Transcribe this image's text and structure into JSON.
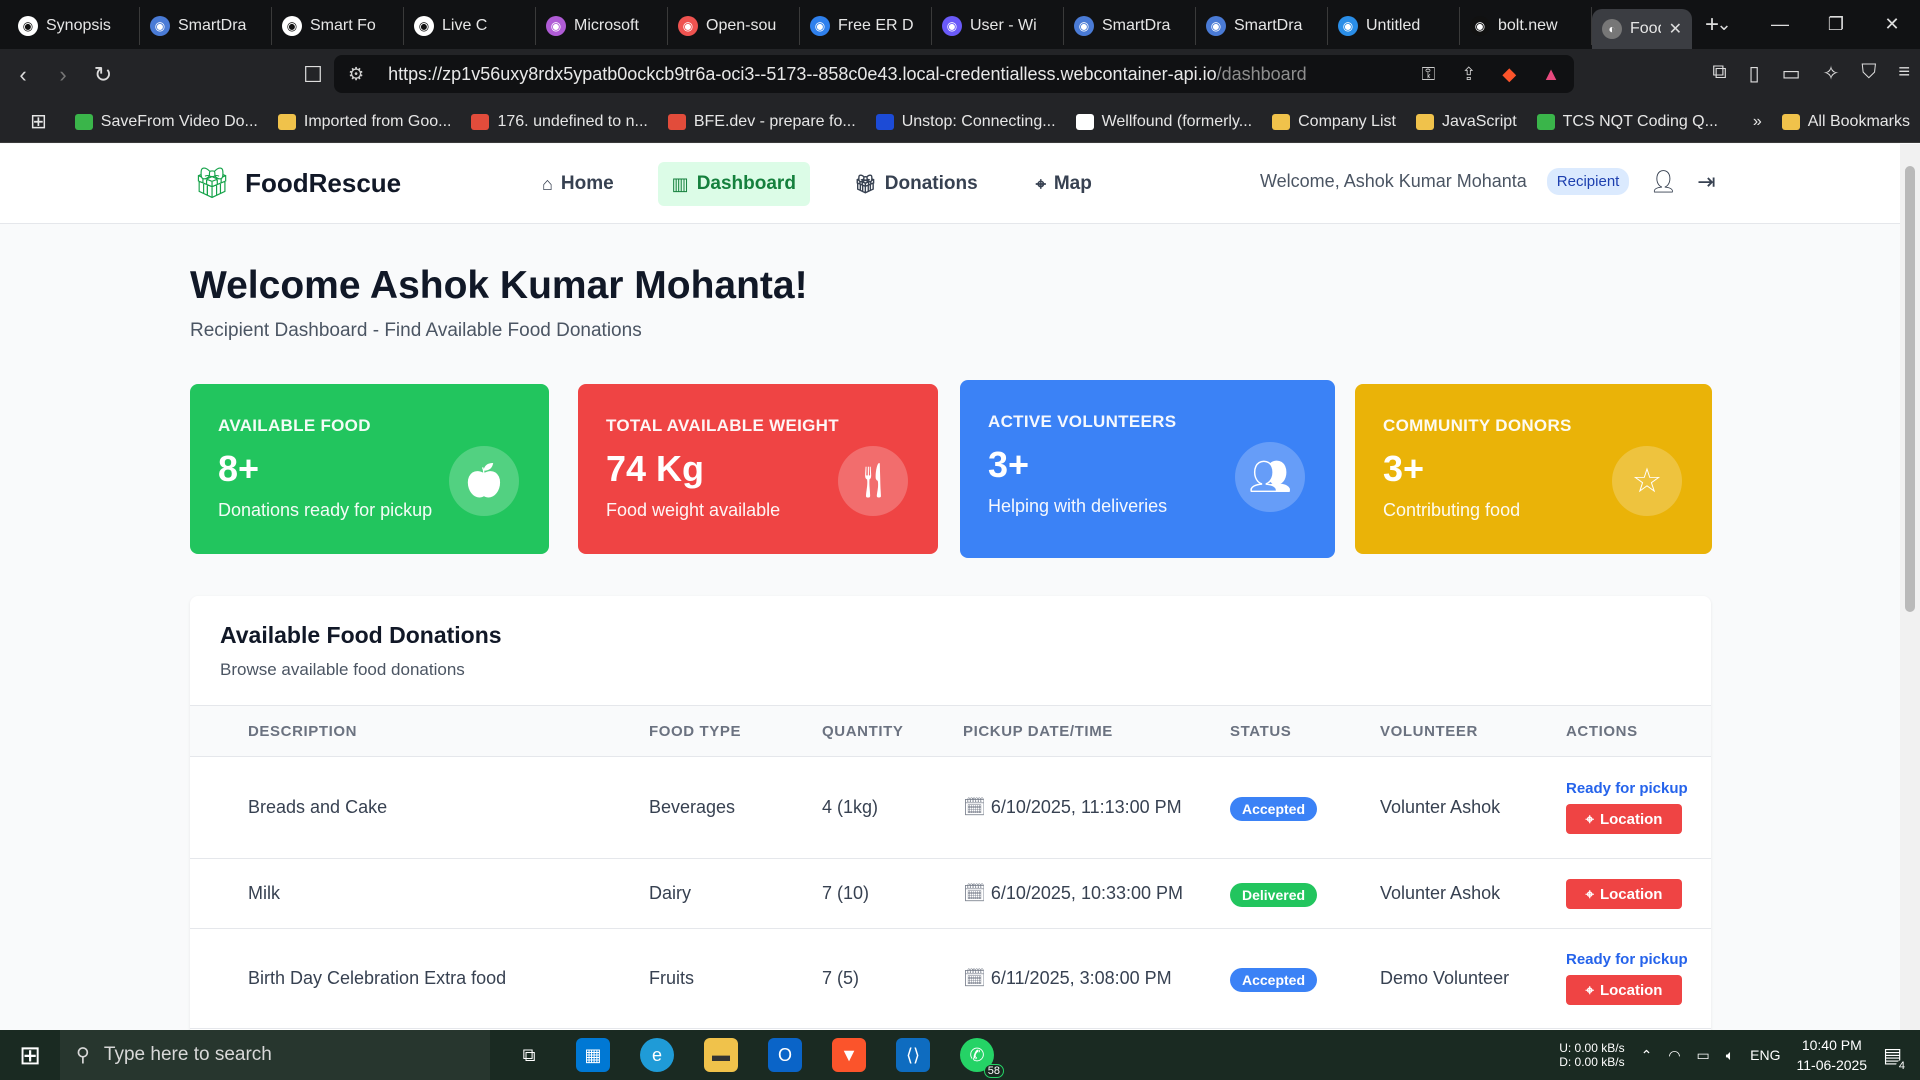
{
  "browser": {
    "tabs": [
      {
        "title": "Synopsis",
        "icon": "github-icon",
        "color": "#ffffff"
      },
      {
        "title": "SmartDra",
        "icon": "app-icon",
        "color": "#4a7bd6"
      },
      {
        "title": "Smart Fo",
        "icon": "openai-icon",
        "color": "#ffffff"
      },
      {
        "title": "Live C",
        "icon": "meet-icon",
        "color": "#ffffff"
      },
      {
        "title": "Microsoft",
        "icon": "copilot-icon",
        "color": "#b05cd6"
      },
      {
        "title": "Open-sou",
        "icon": "chrome-icon",
        "color": "#ef5350"
      },
      {
        "title": "Free ER D",
        "icon": "canva-icon",
        "color": "#2f80ed"
      },
      {
        "title": "User - Wi",
        "icon": "app-icon",
        "color": "#6a5af9"
      },
      {
        "title": "SmartDra",
        "icon": "app-icon",
        "color": "#4a7bd6"
      },
      {
        "title": "SmartDra",
        "icon": "app-icon",
        "color": "#4a7bd6"
      },
      {
        "title": "Untitled",
        "icon": "app-icon",
        "color": "#2a8ee8"
      },
      {
        "title": "bolt.new",
        "icon": "bolt-icon",
        "color": "#111111"
      }
    ],
    "active_tab": {
      "title": "Food"
    },
    "url_main": "https://zp1v56uxy8rdx5ypatb0ockcb9tr6a-oci3--5173--858c0e43.local-credentialless.webcontainer-api.io",
    "url_path": "/dashboard",
    "bookmarks": [
      {
        "label": "SaveFrom Video Do...",
        "color": "#3ab54a"
      },
      {
        "label": "Imported from Goo...",
        "color": "#f0c24b"
      },
      {
        "label": "176. undefined to n...",
        "color": "#e24c3b"
      },
      {
        "label": "BFE.dev - prepare fo...",
        "color": "#e24c3b"
      },
      {
        "label": "Unstop: Connecting...",
        "color": "#1c4bd6"
      },
      {
        "label": "Wellfound (formerly...",
        "color": "#ffffff"
      },
      {
        "label": "Company List",
        "color": "#f0c24b"
      },
      {
        "label": "JavaScript",
        "color": "#f0c24b"
      },
      {
        "label": "TCS NQT Coding Q...",
        "color": "#3ab54a"
      }
    ],
    "all_bookmarks": "All Bookmarks"
  },
  "app": {
    "brand": "FoodRescue",
    "nav": [
      {
        "label": "Home",
        "icon": "home-icon",
        "active": false
      },
      {
        "label": "Dashboard",
        "icon": "chart-icon",
        "active": true
      },
      {
        "label": "Donations",
        "icon": "gift-icon",
        "active": false
      },
      {
        "label": "Map",
        "icon": "map-pin-icon",
        "active": false
      }
    ],
    "welcome": "Welcome, Ashok Kumar Mohanta",
    "role": "Recipient"
  },
  "dashboard": {
    "title": "Welcome Ashok Kumar Mohanta!",
    "subtitle": "Recipient Dashboard - Find Available Food Donations",
    "stats": [
      {
        "label": "AVAILABLE FOOD",
        "value": "8+",
        "desc": "Donations ready for pickup",
        "icon": "apple-icon",
        "color": "#22c55e"
      },
      {
        "label": "TOTAL AVAILABLE WEIGHT",
        "value": "74 Kg",
        "desc": "Food weight available",
        "icon": "utensils-icon",
        "color": "#ef4444"
      },
      {
        "label": "ACTIVE VOLUNTEERS",
        "value": "3+",
        "desc": "Helping with deliveries",
        "icon": "users-icon",
        "color": "#3b82f6"
      },
      {
        "label": "COMMUNITY DONORS",
        "value": "3+",
        "desc": "Contributing food",
        "icon": "star-icon",
        "color": "#eab308"
      }
    ],
    "donations": {
      "title": "Available Food Donations",
      "subtitle": "Browse available food donations",
      "columns": [
        "DESCRIPTION",
        "FOOD TYPE",
        "QUANTITY",
        "PICKUP DATE/TIME",
        "STATUS",
        "VOLUNTEER",
        "ACTIONS"
      ],
      "rows": [
        {
          "description": "Breads and Cake",
          "food_type": "Beverages",
          "quantity": "4 (1kg)",
          "pickup": "6/10/2025, 11:13:00 PM",
          "status": "Accepted",
          "volunteer": "Volunter Ashok",
          "ready": "Ready for pickup",
          "action": "Location"
        },
        {
          "description": "Milk",
          "food_type": "Dairy",
          "quantity": "7 (10)",
          "pickup": "6/10/2025, 10:33:00 PM",
          "status": "Delivered",
          "volunteer": "Volunter Ashok",
          "ready": "",
          "action": "Location"
        },
        {
          "description": "Birth Day Celebration Extra food",
          "food_type": "Fruits",
          "quantity": "7 (5)",
          "pickup": "6/11/2025, 3:08:00 PM",
          "status": "Accepted",
          "volunteer": "Demo Volunteer",
          "ready": "Ready for pickup",
          "action": "Location"
        }
      ],
      "status_colors": {
        "Accepted": "#3b82f6",
        "Delivered": "#22c55e"
      }
    }
  },
  "taskbar": {
    "search_placeholder": "Type here to search",
    "whatsapp_badge": "58",
    "net_up": "0.00 kB/s",
    "net_down": "0.00 kB/s",
    "net_up_label": "U:",
    "net_down_label": "D:",
    "language": "ENG",
    "time": "10:40 PM",
    "date": "11-06-2025",
    "notifications": "4"
  }
}
